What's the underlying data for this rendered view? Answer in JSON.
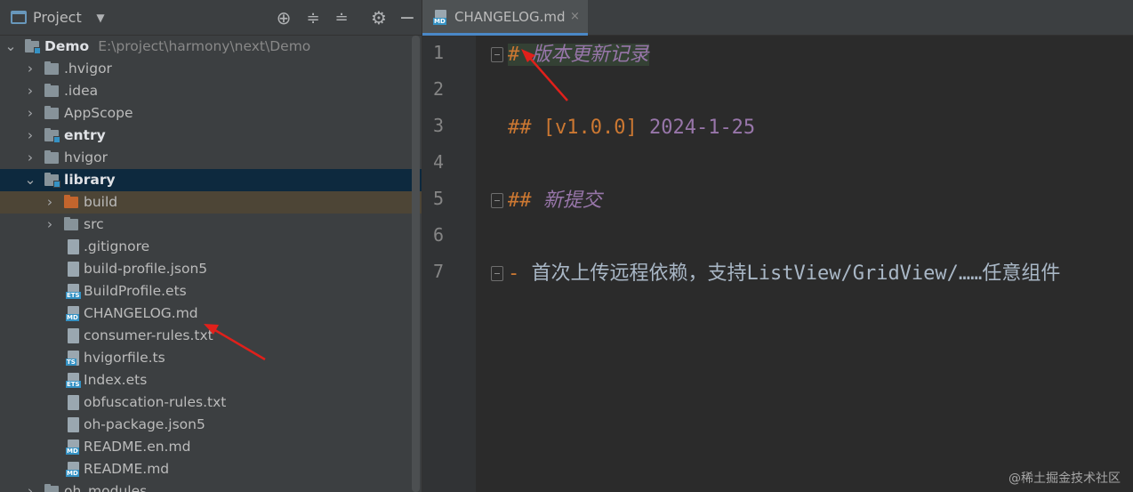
{
  "project_panel": {
    "title": "Project",
    "dropdown_icon": "chevron-down-icon",
    "actions": [
      "locate-icon",
      "expand-all-icon",
      "collapse-all-icon",
      "gear-icon",
      "minimize-icon"
    ]
  },
  "tree": {
    "root": {
      "name": "Demo",
      "path": "E:\\project\\harmony\\next\\Demo"
    },
    "items": [
      {
        "label": "Demo",
        "path": "E:\\project\\harmony\\next\\Demo"
      },
      {
        "label": ".hvigor"
      },
      {
        "label": ".idea"
      },
      {
        "label": "AppScope"
      },
      {
        "label": "entry"
      },
      {
        "label": "hvigor"
      },
      {
        "label": "library"
      },
      {
        "label": "build"
      },
      {
        "label": "src"
      },
      {
        "label": ".gitignore"
      },
      {
        "label": "build-profile.json5"
      },
      {
        "label": "BuildProfile.ets"
      },
      {
        "label": "CHANGELOG.md"
      },
      {
        "label": "consumer-rules.txt"
      },
      {
        "label": "hvigorfile.ts"
      },
      {
        "label": "Index.ets"
      },
      {
        "label": "obfuscation-rules.txt"
      },
      {
        "label": "oh-package.json5"
      },
      {
        "label": "README.en.md"
      },
      {
        "label": "README.md"
      },
      {
        "label": "oh_modules"
      }
    ]
  },
  "editor": {
    "tab": {
      "label": "CHANGELOG.md",
      "close": "×",
      "badge": "MD"
    },
    "lines": [
      {
        "n": "1",
        "hash": "#",
        "text": "版本更新记录"
      },
      {
        "n": "2"
      },
      {
        "n": "3",
        "hash": "##",
        "version": "[v1.0.0]",
        "date": "2024-1-25"
      },
      {
        "n": "4"
      },
      {
        "n": "5",
        "hash": "##",
        "text": "新提交"
      },
      {
        "n": "6"
      },
      {
        "n": "7",
        "hash": "-",
        "text": "首次上传远程依赖，支持ListView/GridView/……任意组件"
      }
    ]
  },
  "watermark": "@稀土掘金技术社区",
  "colors": {
    "panel_bg": "#3c3f41",
    "editor_bg": "#2b2b2b",
    "selection": "#0d293e",
    "keyword_orange": "#cc7832",
    "markdown_purple": "#9876aa",
    "annotation_arrow": "#e0201b"
  }
}
